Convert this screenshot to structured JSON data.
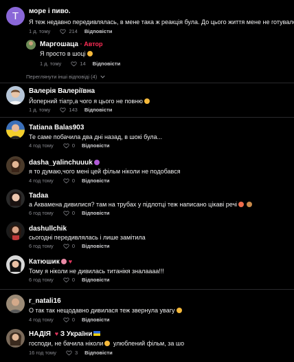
{
  "reply_label": "Відповісти",
  "comments": [
    {
      "avatar_letter": "T",
      "name": "море і пиво.",
      "text": "Я теж недавно передивлялась, в мене така ж реакція була. До цього життя мене не готувало",
      "time": "1 д. тому",
      "likes": "214"
    },
    {
      "name": "Маргошаца",
      "badge": "· Автор",
      "text": "Я просто в шоці",
      "time": "1 д. тому",
      "likes": "14"
    },
    {
      "name": "Валерія Валеріївна",
      "text": "Йоперний тіатр,а чого я цього не повню",
      "time": "1 д. тому",
      "likes": "143"
    },
    {
      "name": "Tatiana Balas903",
      "text": "Те саме побачила два дні назад, в шокі була...",
      "time": "4 год тому",
      "likes": "0"
    },
    {
      "name": "dasha_yalinchuuuk",
      "text": "я то думаю,чого мені цей фільм ніколи не подобався",
      "time": "4 год тому",
      "likes": "0"
    },
    {
      "name": "Tadaa",
      "text": "а Аквамена дивилися? там на трубах у підлотці теж написано цікаві речі",
      "time": "6 год тому",
      "likes": "0"
    },
    {
      "name": "dashullchik",
      "text": "сьогодні передивлялась і лише замітила",
      "time": "6 год тому",
      "likes": "0"
    },
    {
      "name": "Катюшик",
      "text": "Тому я ніколи не дивилась титанікя зналаааа!!!",
      "time": "6 год тому",
      "likes": "0"
    },
    {
      "name": "r_natali16",
      "text": "О так так нещодавно дивилася теж звернула увагу",
      "time": "4 год тому",
      "likes": "0"
    },
    {
      "name": "НАДІЯ",
      "name_suffix": "З України",
      "text": "господи, не бачила ніколи",
      "text_suffix": "улюблений фільм, за шо",
      "time": "16 год тому",
      "likes": "3"
    }
  ],
  "more_replies": "Переглянути інші відповіді (4)",
  "colors": {
    "background": "#000000",
    "author_badge": "#fe2c55",
    "meta": "#8a8b91",
    "avatar_letter_bg": "#8a67d8"
  }
}
